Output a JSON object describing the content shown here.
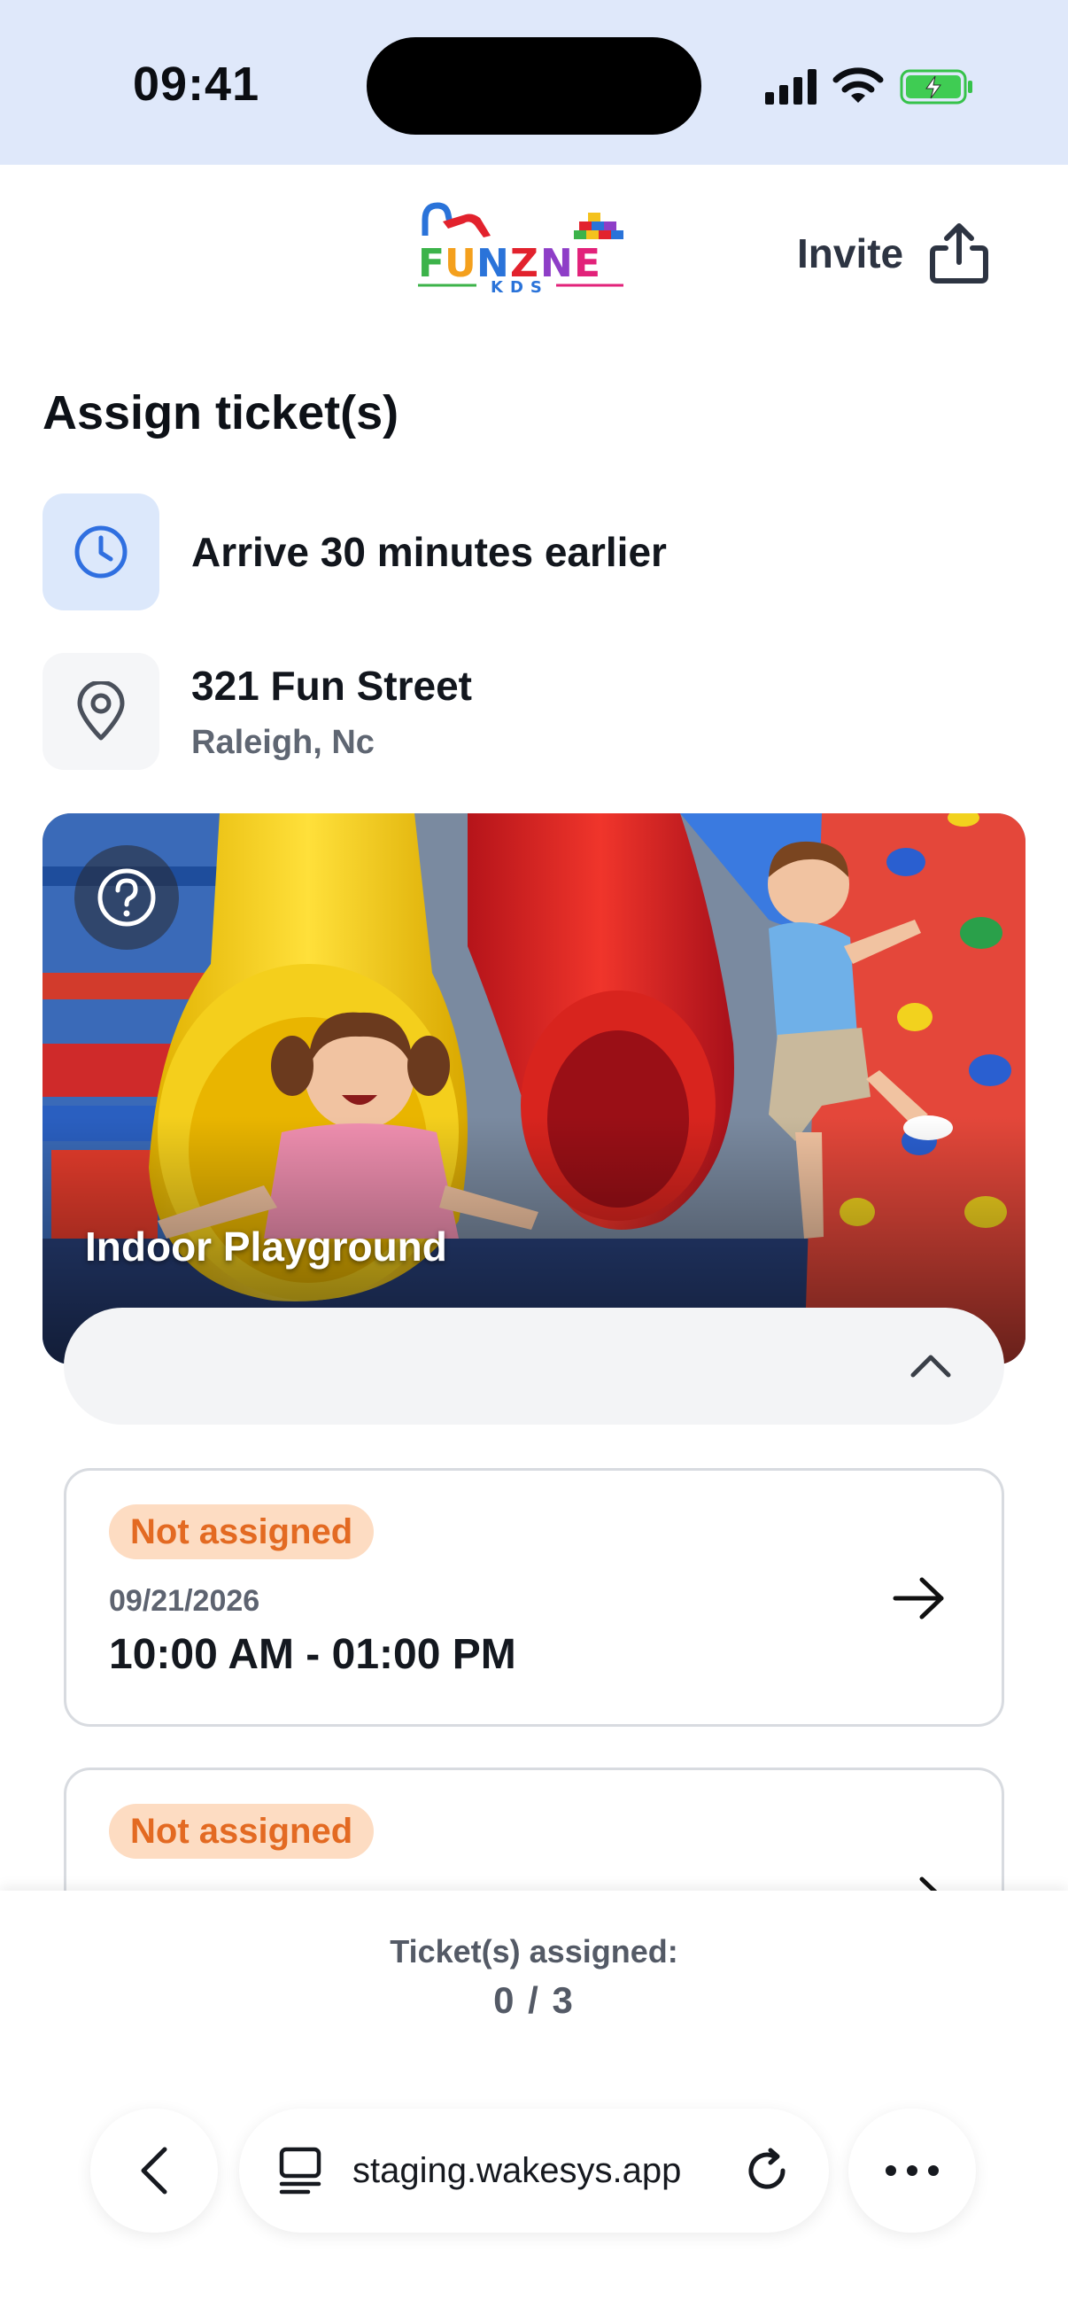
{
  "status_bar": {
    "time": "09:41"
  },
  "header": {
    "logo_text": "FUNZNE KDS",
    "invite_label": "Invite"
  },
  "page": {
    "title": "Assign ticket(s)",
    "arrival_note": "Arrive 30 minutes earlier",
    "address_line1": "321 Fun Street",
    "address_line2": "Raleigh, Nc"
  },
  "hero": {
    "label": "Indoor Playground"
  },
  "tickets": [
    {
      "status": "Not assigned",
      "date": "09/21/2026",
      "time": "10:00 AM - 01:00 PM"
    },
    {
      "status": "Not assigned",
      "date": "",
      "time": ""
    }
  ],
  "summary": {
    "label": "Ticket(s) assigned:",
    "count": "0 / 3"
  },
  "browser": {
    "url": "staging.wakesys.app"
  },
  "colors": {
    "status_bar_bg": "#dfe8fa",
    "badge_bg": "#fddcc2",
    "badge_text": "#e36a22",
    "clock_icon_bg": "#dce8fb",
    "clock_icon": "#2f6fe0"
  }
}
